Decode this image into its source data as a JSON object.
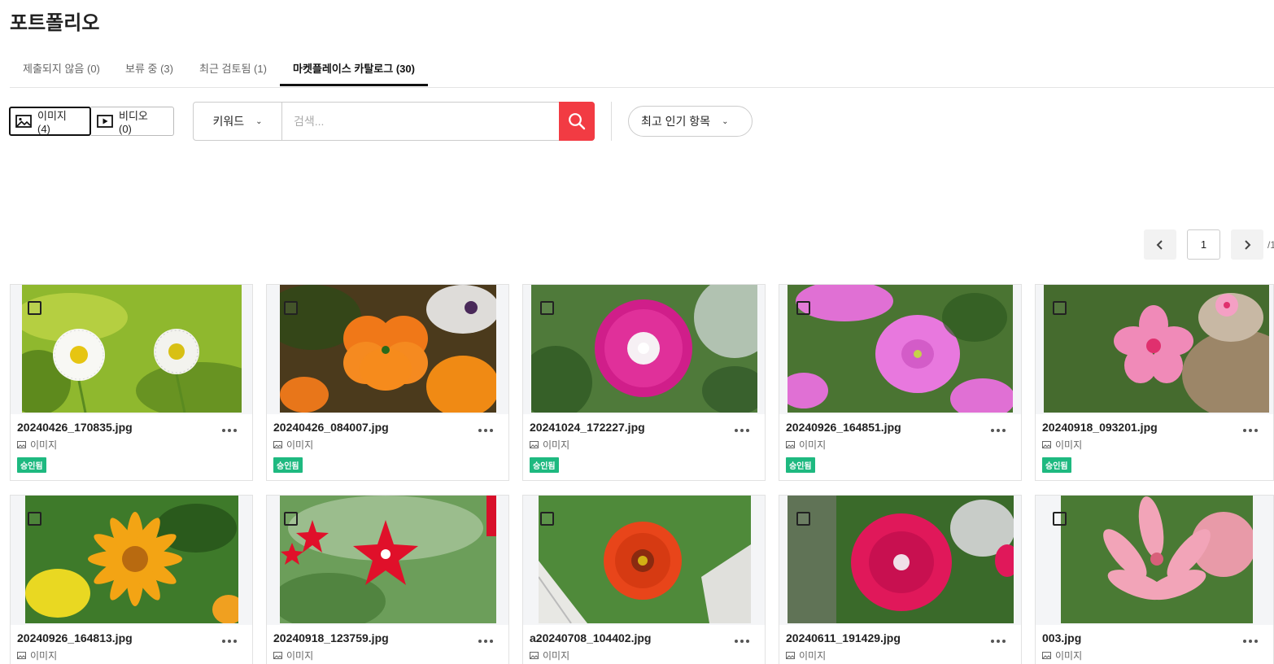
{
  "page_title": "포트폴리오",
  "tabs": [
    {
      "label": "제출되지 않음 (0)"
    },
    {
      "label": "보류 중 (3)"
    },
    {
      "label": "최근 검토됨 (1)"
    },
    {
      "label": "마켓플레이스 카탈로그 (30)"
    }
  ],
  "media_toggle": {
    "image_label": "이미지 (4)",
    "video_label": "비디오 (0)"
  },
  "search": {
    "type_label": "키워드",
    "placeholder": "검색..."
  },
  "sort": {
    "label": "최고 인기 항목"
  },
  "pagination": {
    "current": "1",
    "total": "/1"
  },
  "cards": [
    {
      "name": "20240426_170835.jpg",
      "type": "이미지",
      "badge": "승인됨"
    },
    {
      "name": "20240426_084007.jpg",
      "type": "이미지",
      "badge": "승인됨"
    },
    {
      "name": "20241024_172227.jpg",
      "type": "이미지",
      "badge": "승인됨"
    },
    {
      "name": "20240926_164851.jpg",
      "type": "이미지",
      "badge": "승인됨"
    },
    {
      "name": "20240918_093201.jpg",
      "type": "이미지",
      "badge": "승인됨"
    },
    {
      "name": "20240926_164813.jpg",
      "type": "이미지"
    },
    {
      "name": "20240918_123759.jpg",
      "type": "이미지"
    },
    {
      "name": "a20240708_104402.jpg",
      "type": "이미지"
    },
    {
      "name": "20240611_191429.jpg",
      "type": "이미지"
    },
    {
      "name": "003.jpg",
      "type": "이미지"
    }
  ],
  "colors": {
    "accent_red": "#f23b43",
    "approved_green": "#1eb980"
  }
}
